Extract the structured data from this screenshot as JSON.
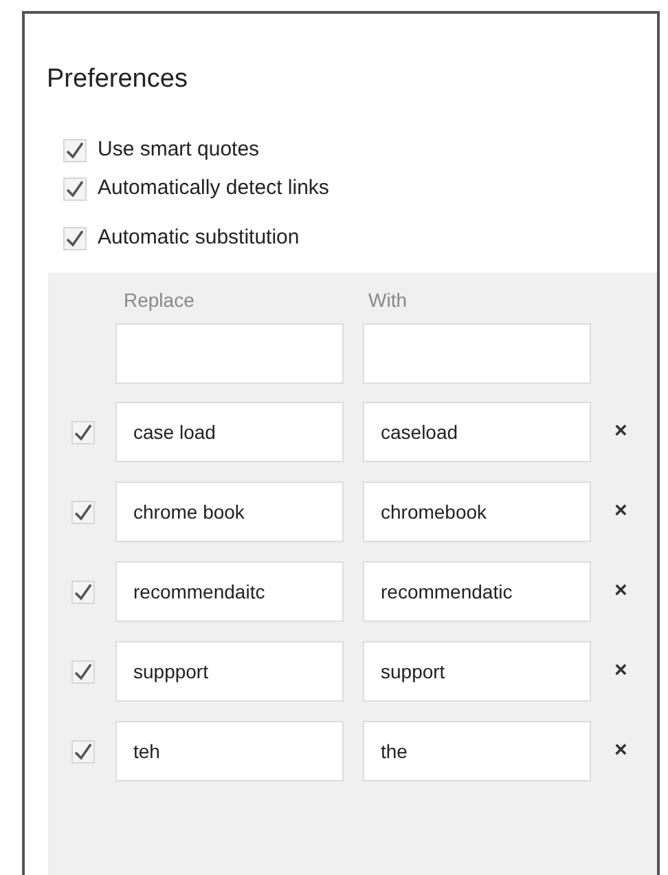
{
  "title": "Preferences",
  "options": [
    {
      "label": "Use smart quotes",
      "checked": true
    },
    {
      "label": "Automatically detect links",
      "checked": true
    },
    {
      "label": "Automatic substitution",
      "checked": true
    }
  ],
  "substitution": {
    "columns": [
      "Replace",
      "With"
    ],
    "rows": [
      {
        "checked": true,
        "replace": "case load",
        "with": "caseload",
        "remove": "×"
      },
      {
        "checked": true,
        "replace": "chrome book",
        "with": "chromebook",
        "remove": "×"
      },
      {
        "checked": true,
        "replace": "recommendaitc",
        "with": "recommendatic",
        "remove": "×"
      },
      {
        "checked": true,
        "replace": "suppport",
        "with": "support",
        "remove": "×"
      },
      {
        "checked": true,
        "replace": "teh",
        "with": "the",
        "remove": "×"
      }
    ]
  }
}
